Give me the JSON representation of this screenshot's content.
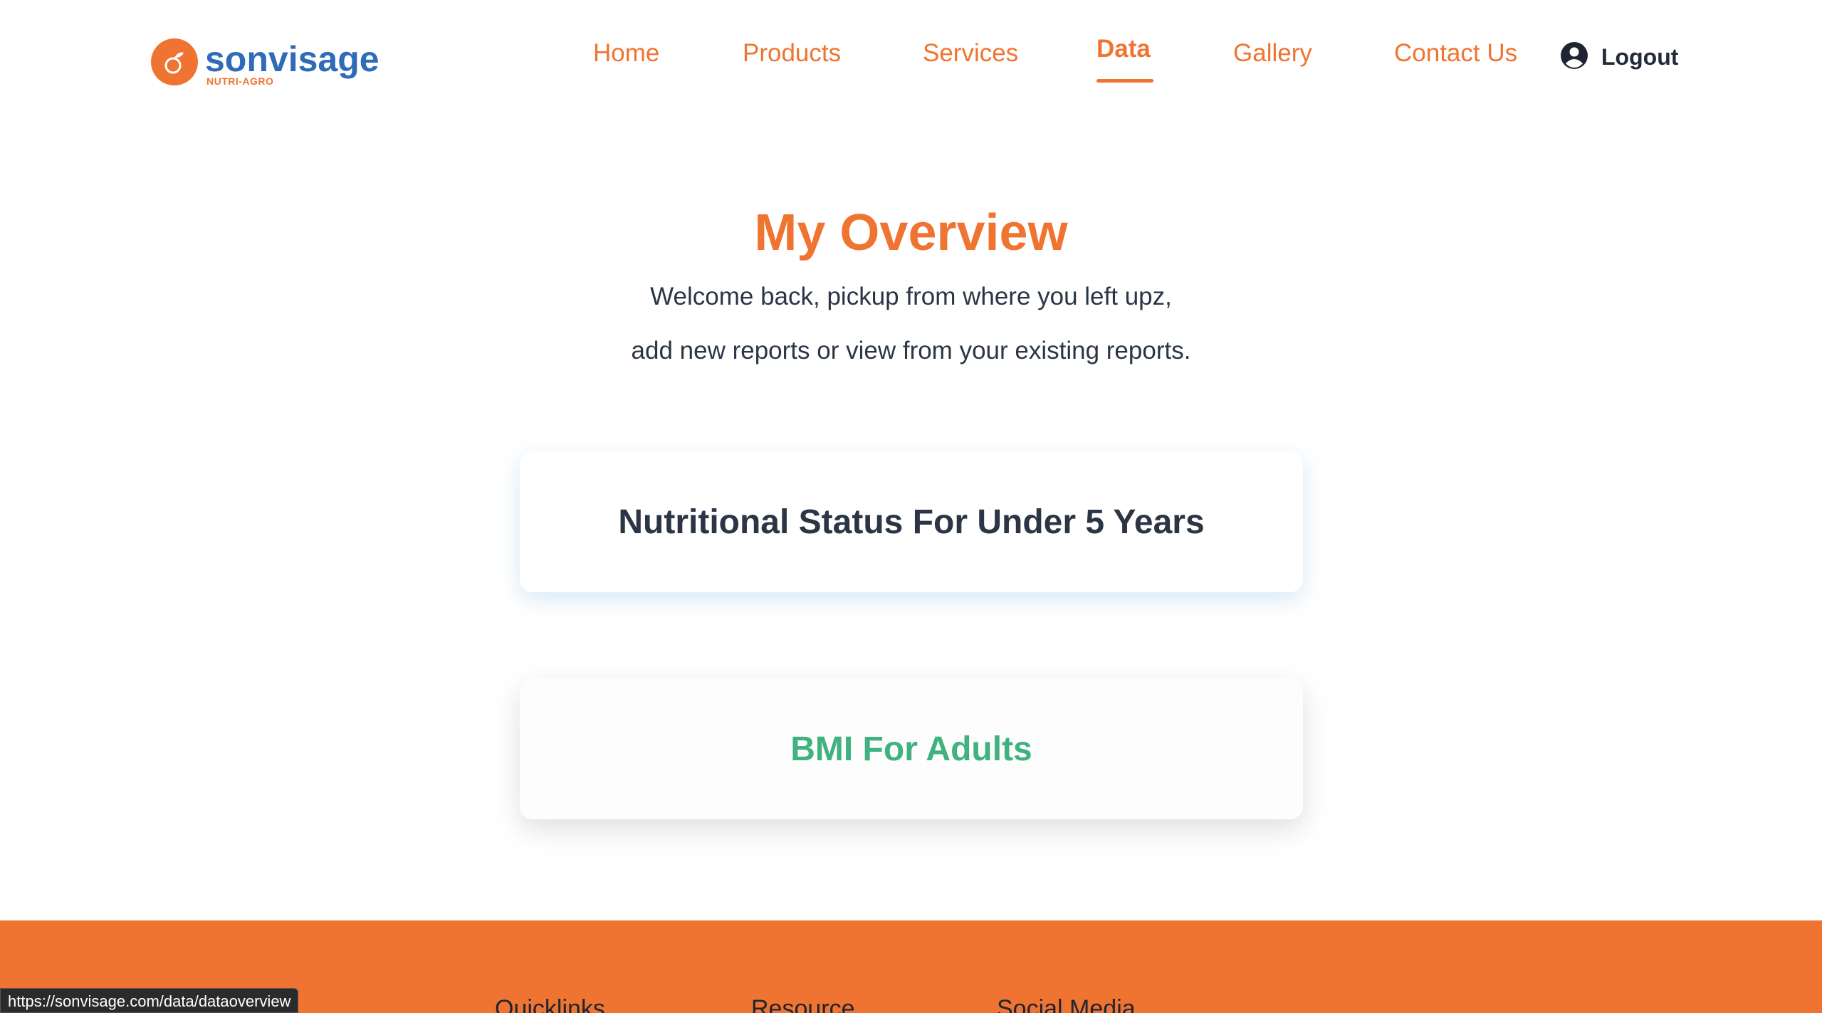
{
  "brand": {
    "name": "sonvisage",
    "tagline": "NUTRI-AGRO",
    "color_primary": "#f07431",
    "color_brand_blue": "#2f6bb8"
  },
  "nav": {
    "items": [
      {
        "label": "Home",
        "active": false
      },
      {
        "label": "Products",
        "active": false
      },
      {
        "label": "Services",
        "active": false
      },
      {
        "label": "Data",
        "active": true
      },
      {
        "label": "Gallery",
        "active": false
      },
      {
        "label": "Contact Us",
        "active": false
      }
    ],
    "logout_label": "Logout",
    "logout_icon": "user-circle-icon"
  },
  "main": {
    "title": "My Overview",
    "subtitle_line1": "Welcome back, pickup from where you left upz,",
    "subtitle_line2": "add new reports or view from your existing reports.",
    "cards": [
      {
        "label": "Nutritional Status For Under 5 Years"
      },
      {
        "label": "BMI For Adults"
      }
    ]
  },
  "footer": {
    "headings": [
      "Quicklinks",
      "Resource",
      "Social Media"
    ]
  },
  "status_bar": {
    "url": "https://sonvisage.com/data/dataoverview"
  }
}
